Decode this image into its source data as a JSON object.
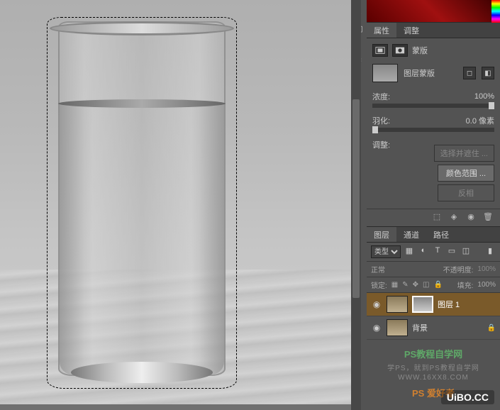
{
  "panels": {
    "properties": {
      "tab1": "属性",
      "tab2": "调整"
    },
    "mask": {
      "title": "蒙版",
      "thumb_label": "图层蒙版"
    },
    "density": {
      "label": "浓度:",
      "value": "100%"
    },
    "feather": {
      "label": "羽化:",
      "value": "0.0 像素"
    },
    "refine": {
      "label": "调整:",
      "btn1": "选择并遮住 ...",
      "btn2": "颜色范围 ...",
      "btn3": "反相"
    }
  },
  "layers": {
    "tab1": "图层",
    "tab2": "通道",
    "tab3": "路径",
    "kind_label": "类型",
    "blend_mode": "正常",
    "opacity_label": "不透明度:",
    "opacity_value": "100%",
    "lock_label": "锁定:",
    "fill_label": "填充:",
    "fill_value": "100%",
    "layer1": "图层 1",
    "background": "背景"
  },
  "watermark": {
    "line1": "PS教程自学网",
    "line2": "学PS，就到PS教程自学网",
    "line3": "WWW.16XX8.COM",
    "ps_logo": "PS 爱好者"
  },
  "footer_brand": "UiBO.CC"
}
